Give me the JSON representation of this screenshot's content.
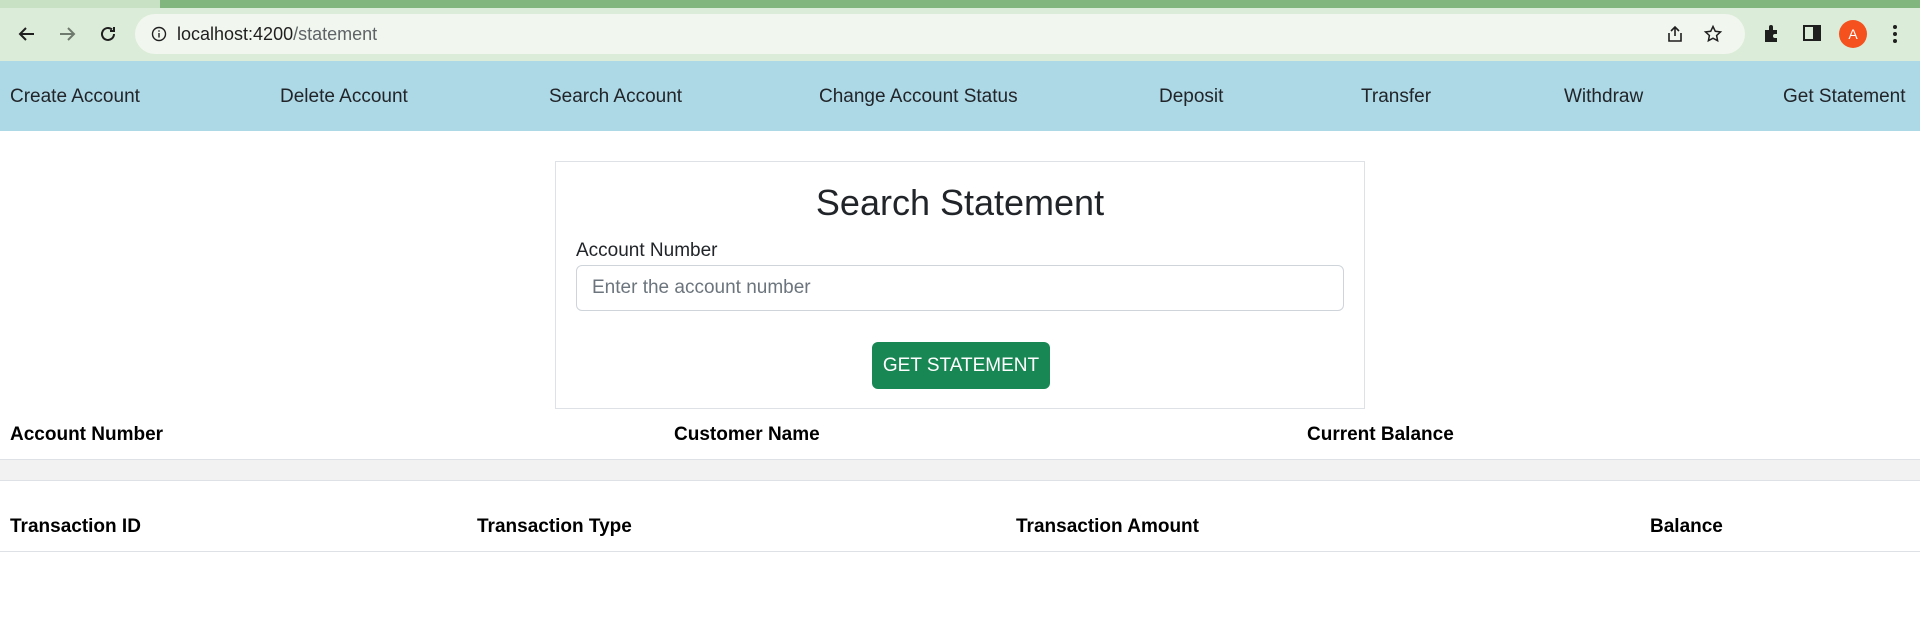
{
  "browser": {
    "url_host": "localhost:4200",
    "url_path": "/statement",
    "avatar_initial": "A",
    "icons": [
      "back-arrow-icon",
      "forward-arrow-icon",
      "reload-icon",
      "info-icon",
      "share-icon",
      "star-icon",
      "extensions-icon",
      "side-panel-icon",
      "kebab-menu-icon"
    ]
  },
  "nav": {
    "items": [
      {
        "label": "Create Account"
      },
      {
        "label": "Delete Account"
      },
      {
        "label": "Search Account"
      },
      {
        "label": "Change Account Status"
      },
      {
        "label": "Deposit"
      },
      {
        "label": "Transfer"
      },
      {
        "label": "Withdraw"
      },
      {
        "label": "Get Statement"
      }
    ]
  },
  "search": {
    "title": "Search Statement",
    "field_label": "Account Number",
    "placeholder": "Enter the account number",
    "value": "",
    "button_label": "GET STATEMENT"
  },
  "account_table": {
    "headers": [
      "Account Number",
      "Customer Name",
      "Current Balance"
    ]
  },
  "transaction_table": {
    "headers": [
      "Transaction ID",
      "Transaction Type",
      "Transaction Amount",
      "Balance"
    ]
  },
  "colors": {
    "nav_bg": "#add8e6",
    "button_bg": "#198754",
    "avatar_bg": "#f4511e",
    "chrome_accent": "#81b67e"
  }
}
